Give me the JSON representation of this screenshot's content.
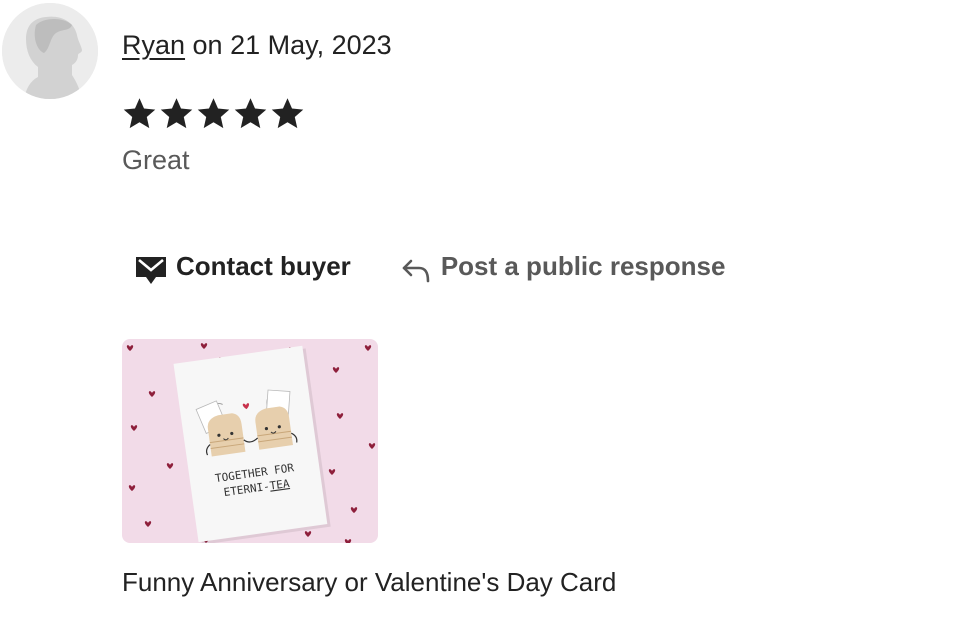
{
  "review": {
    "reviewer_name": "Ryan",
    "date_text": " on 21 May, 2023",
    "rating": 5,
    "rating_max": 5,
    "text": "Great"
  },
  "actions": {
    "contact_label": "Contact buyer",
    "respond_label": "Post a public response",
    "contact_icon": "envelope-icon",
    "respond_icon": "reply-arrow-icon"
  },
  "product": {
    "title": "Funny Anniversary or Valentine's Day Card",
    "card_text_line1": "TOGETHER FOR",
    "card_text_line2": "ETERNI-",
    "card_text_line2_emph": "TEA"
  },
  "colors": {
    "text": "#222222",
    "muted": "#595959",
    "image_background": "#f2dbe8",
    "heart": "#8e1f3b"
  }
}
